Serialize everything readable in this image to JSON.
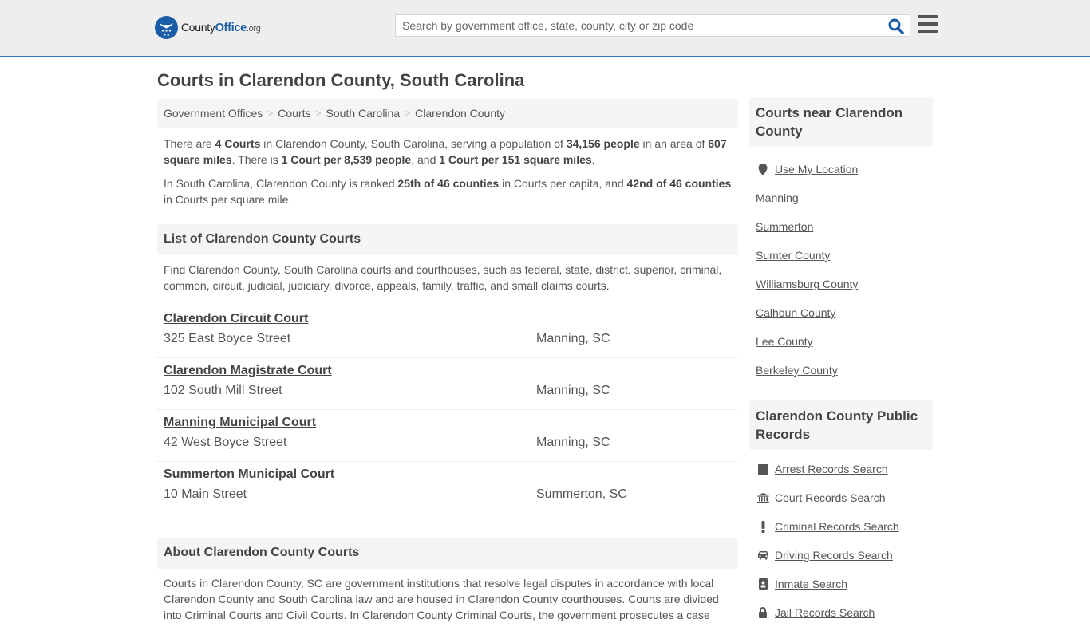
{
  "header": {
    "logo": {
      "part1": "County",
      "part2": "Office",
      "part3": ".org"
    },
    "search_placeholder": "Search by government office, state, county, city or zip code",
    "search_value": "",
    "accent_color": "#3276b1",
    "brand_color": "#1a5ca5"
  },
  "page": {
    "title": "Courts in Clarendon County, South Carolina"
  },
  "breadcrumb": [
    "Government Offices",
    "Courts",
    "South Carolina",
    "Clarendon County"
  ],
  "intro": {
    "p1": {
      "t1": "There are ",
      "b1": "4 Courts",
      "t2": " in Clarendon County, South Carolina, serving a population of ",
      "b2": "34,156 people",
      "t3": " in an area of ",
      "b3": "607 square miles",
      "t4": ". There is ",
      "b4": "1 Court per 8,539 people",
      "t5": ", and ",
      "b5": "1 Court per 151 square miles",
      "t6": "."
    },
    "p2": {
      "t1": "In South Carolina, Clarendon County is ranked ",
      "b1": "25th of 46 counties",
      "t2": " in Courts per capita, and ",
      "b2": "42nd of 46 counties",
      "t3": " in Courts per square mile."
    }
  },
  "list_section": {
    "heading": "List of Clarendon County Courts",
    "description": "Find Clarendon County, South Carolina courts and courthouses, such as federal, state, district, superior, criminal, common, circuit, judicial, judiciary, divorce, appeals, family, traffic, and small claims courts.",
    "courts": [
      {
        "name": "Clarendon Circuit Court",
        "address": "325 East Boyce Street",
        "city": "Manning, SC"
      },
      {
        "name": "Clarendon Magistrate Court",
        "address": "102 South Mill Street",
        "city": "Manning, SC"
      },
      {
        "name": "Manning Municipal Court",
        "address": "42 West Boyce Street",
        "city": "Manning, SC"
      },
      {
        "name": "Summerton Municipal Court",
        "address": "10 Main Street",
        "city": "Summerton, SC"
      }
    ]
  },
  "about_section": {
    "heading": "About Clarendon County Courts",
    "text": "Courts in Clarendon County, SC are government institutions that resolve legal disputes in accordance with local Clarendon County and South Carolina law and are housed in Clarendon County courthouses. Courts are divided into Criminal Courts and Civil Courts. In Clarendon County Criminal Courts, the government prosecutes a case"
  },
  "sidebar": {
    "near": {
      "heading": "Courts near Clarendon County",
      "use_location": {
        "label": "Use My Location",
        "icon": "map-marker-icon"
      },
      "items": [
        "Manning",
        "Summerton",
        "Sumter County",
        "Williamsburg County",
        "Calhoun County",
        "Lee County",
        "Berkeley County"
      ]
    },
    "records": {
      "heading": "Clarendon County Public Records",
      "items": [
        {
          "label": "Arrest Records Search",
          "icon": "square-icon"
        },
        {
          "label": "Court Records Search",
          "icon": "courthouse-icon"
        },
        {
          "label": "Criminal Records Search",
          "icon": "exclamation-icon"
        },
        {
          "label": "Driving Records Search",
          "icon": "car-icon"
        },
        {
          "label": "Inmate Search",
          "icon": "id-badge-icon"
        },
        {
          "label": "Jail Records Search",
          "icon": "lock-icon"
        }
      ]
    }
  }
}
